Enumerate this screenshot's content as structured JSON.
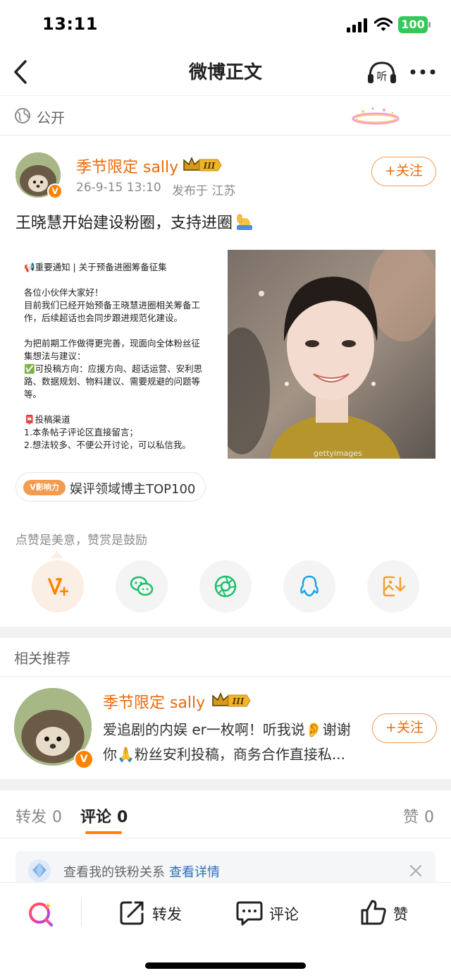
{
  "status_bar": {
    "time": "13:11",
    "battery": "100"
  },
  "nav": {
    "title": "微博正文",
    "listen_label": "听"
  },
  "visibility": {
    "label": "公开"
  },
  "post": {
    "author": "季节限定 sally",
    "level": "III",
    "timestamp": "26-9-15 13:10",
    "location": "发布于 江苏",
    "follow_label": "+关注",
    "text": "王晓慧开始建设粉圈，支持进圈",
    "notice_lines": [
      "📢重要通知 | 关于预备进圈筹备征集",
      "",
      "各位小伙伴大家好！",
      "目前我们已经开始预备王晓慧进圈相关筹备工",
      "作，后续超话也会同步跟进规范化建设。",
      "",
      "为把前期工作做得更完善，现面向全体粉丝征",
      "集想法与建议：",
      "✅可投稿方向：应援方向、超话运营、安利思",
      "路、数据规划、物料建议、需要规避的问题等",
      "等。",
      "",
      "📮投稿渠道",
      "1.本条帖子评论区直接留言；",
      "2.想法较多、不便公开讨论，可以私信我。"
    ],
    "photo_watermark": "gettyimages",
    "influence_badge": "V影响力",
    "influence_text": "娱评领域博主TOP100",
    "like_hint": "点赞是美意，赞赏是鼓励"
  },
  "share_icons": [
    "reward-v-icon",
    "wechat-icon",
    "moments-icon",
    "qq-icon",
    "save-image-icon"
  ],
  "related": {
    "title": "相关推荐",
    "name": "季节限定 sally",
    "level": "III",
    "desc_line1": "爱追剧的内娱 er一枚啊！听我说👂谢谢",
    "desc_line2": "你🙏粉丝安利投稿，商务合作直接私...",
    "follow_label": "+关注"
  },
  "tabs": [
    {
      "label": "转发",
      "count": "0"
    },
    {
      "label": "评论",
      "count": "0"
    },
    {
      "label": "赞",
      "count": "0"
    }
  ],
  "fans_banner": {
    "text": "查看我的铁粉关系",
    "link": "查看详情"
  },
  "bottom_bar": {
    "repost": "转发",
    "comment": "评论",
    "like": "赞"
  },
  "colors": {
    "accent": "#ff8200",
    "author": "#e86b0c",
    "link": "#2d6fb7"
  }
}
